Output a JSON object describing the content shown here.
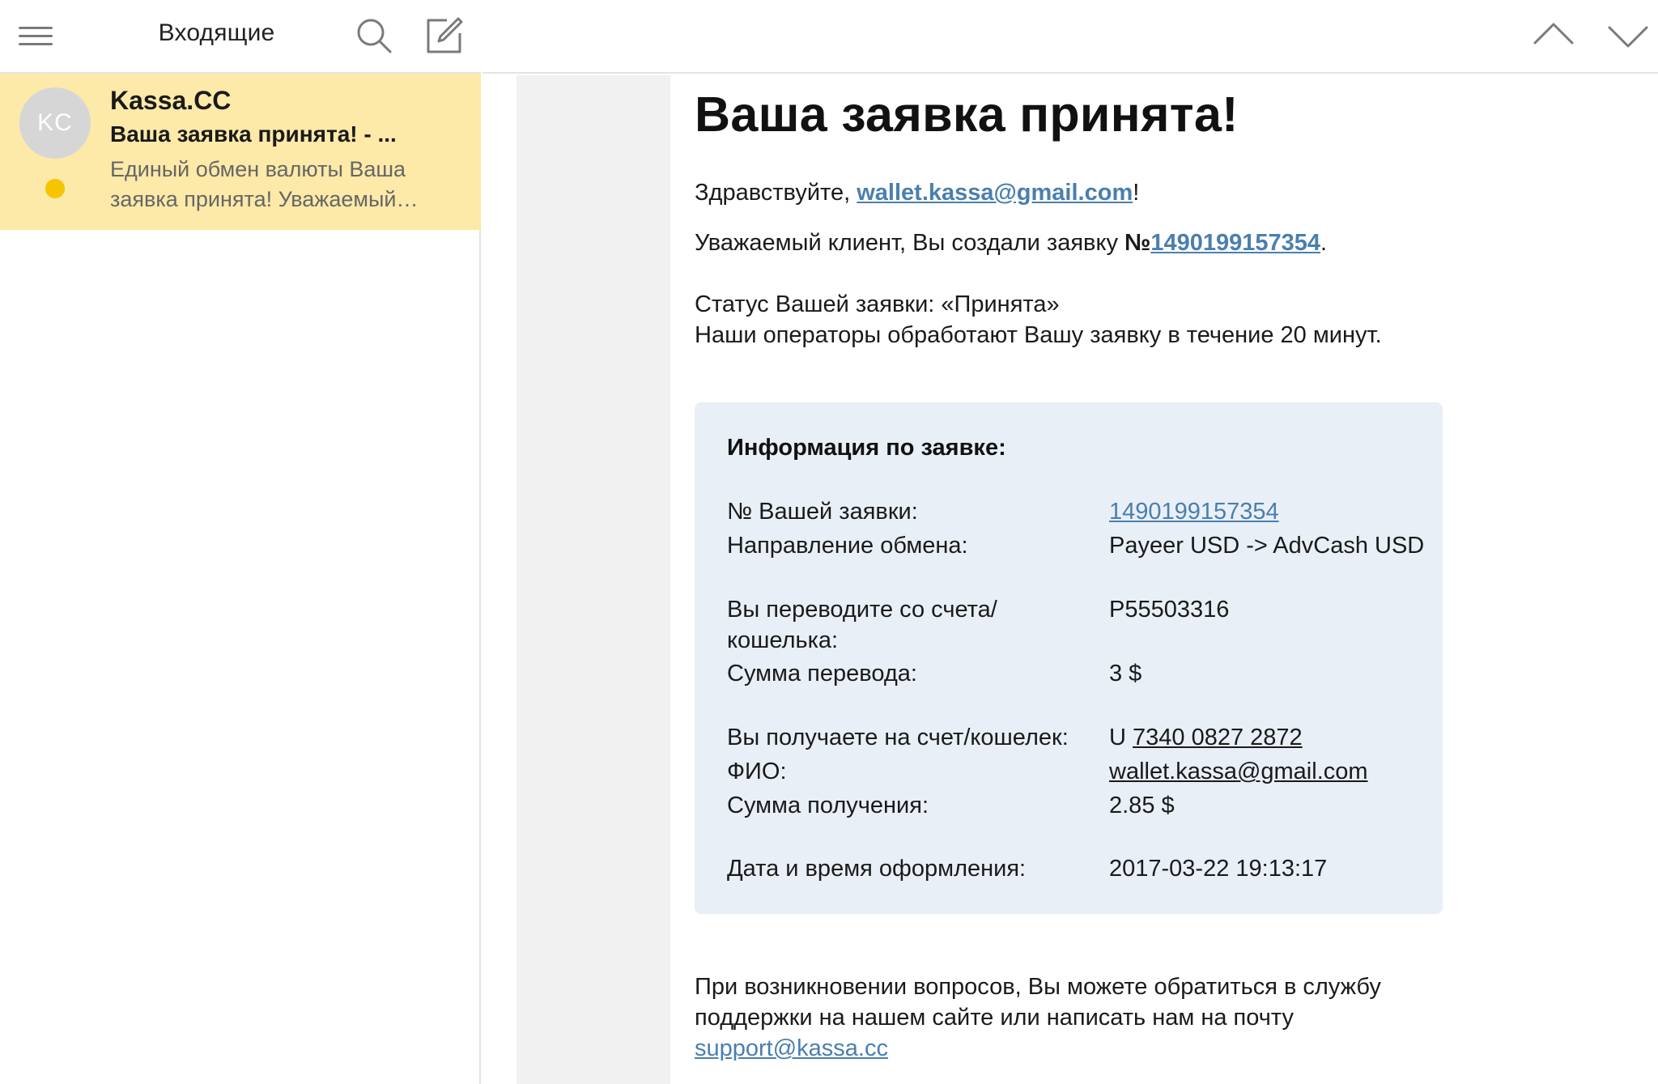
{
  "sidebar": {
    "title": "Входящие"
  },
  "message_list": [
    {
      "avatar_initials": "KC",
      "sender": "Kassa.CC",
      "subject": "Ваша заявка принята! - ...",
      "preview": " Единый обмен валюты Ваша заявка принята! Уважаемый…",
      "unread": true
    }
  ],
  "icons": {
    "menu": "hamburger-icon",
    "search": "search-icon",
    "compose": "compose-icon",
    "prev": "chevron-up-icon",
    "next": "chevron-down-icon"
  },
  "colors": {
    "selected_item_bg": "#fde9a8",
    "unread_dot": "#f6c500",
    "link": "#4a7fae",
    "info_box_bg": "#e9eff6"
  },
  "email": {
    "heading": "Ваша заявка принята!",
    "greeting_prefix": "Здравствуйте, ",
    "greeting_email": "wallet.kassa@gmail.com",
    "greeting_suffix": "!",
    "created_prefix": "Уважаемый клиент, Вы создали заявку ",
    "created_no_sign": "№",
    "created_number": "1490199157354",
    "created_suffix": ".",
    "status_line": "Статус Вашей заявки: «Принята»",
    "operators_line": "Наши операторы обработают Вашу заявку в течение 20 минут.",
    "info": {
      "title": "Информация по заявке:",
      "rows": [
        {
          "label": "№ Вашей заявки:",
          "value": "1490199157354"
        },
        {
          "label": "Направление обмена:",
          "value": "Payeer USD -> AdvCash USD"
        },
        {
          "label": "Вы переводите со счета/ кошелька:",
          "value": "P55503316"
        },
        {
          "label": "Сумма перевода:",
          "value": "3 $"
        },
        {
          "label": "Вы получаете на счет/кошелек:",
          "value_prefix": "U ",
          "value": "7340 0827 2872"
        },
        {
          "label": "ФИО:",
          "value": "wallet.kassa@gmail.com"
        },
        {
          "label": "Сумма получения:",
          "value": "2.85 $"
        },
        {
          "label": "Дата и время оформления:",
          "value": "2017-03-22 19:13:17"
        }
      ]
    },
    "footer_text": "При возникновении вопросов, Вы можете обратиться в службу поддержки на нашем сайте или написать нам на почту",
    "footer_link": "support@kassa.cc"
  }
}
